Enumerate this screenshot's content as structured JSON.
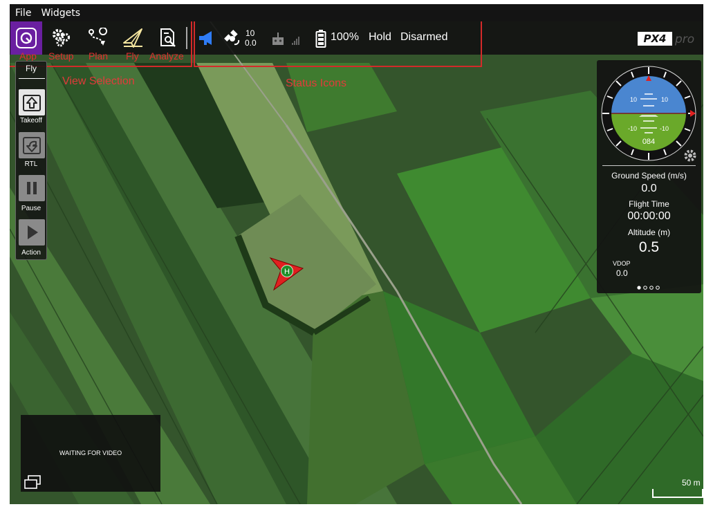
{
  "menu": {
    "file": "File",
    "widgets": "Widgets"
  },
  "toolbar": {
    "app_label": "App",
    "setup_label": "Setup",
    "plan_label": "Plan",
    "fly_label": "Fly",
    "analyze_label": "Analyze",
    "active_view": "App"
  },
  "status": {
    "satellite_count": "10",
    "hdop": "0.0",
    "battery": "100%",
    "flight_mode": "Hold",
    "arm_state": "Disarmed"
  },
  "annotations": {
    "view_selection": "View Selection",
    "status_icons": "Status Icons"
  },
  "fly_panel": {
    "title": "Fly",
    "takeoff": "Takeoff",
    "rtl": "RTL",
    "pause": "Pause",
    "action": "Action"
  },
  "instrument": {
    "pitch_up_left": "10",
    "pitch_up_right": "10",
    "pitch_down_left": "-10",
    "pitch_down_right": "-10",
    "heading": "084",
    "ground_speed_label": "Ground Speed (m/s)",
    "ground_speed_value": "0.0",
    "flight_time_label": "Flight Time",
    "flight_time_value": "00:00:00",
    "altitude_label": "Altitude (m)",
    "altitude_value": "0.5",
    "vdop_label": "VDOP",
    "vdop_value": "0.0"
  },
  "video": {
    "message": "WAITING FOR VIDEO"
  },
  "map": {
    "home_marker": "H",
    "scale": "50 m"
  },
  "brand": {
    "logo_text": "PX4",
    "logo_suffix": "pro"
  },
  "colors": {
    "active_tab": "#6a1fa0",
    "annotation": "#e33a3a",
    "vehicle": "#e02020",
    "home": "#1f8f2a",
    "sky": "#4a86d0",
    "ground": "#6aa92a"
  }
}
